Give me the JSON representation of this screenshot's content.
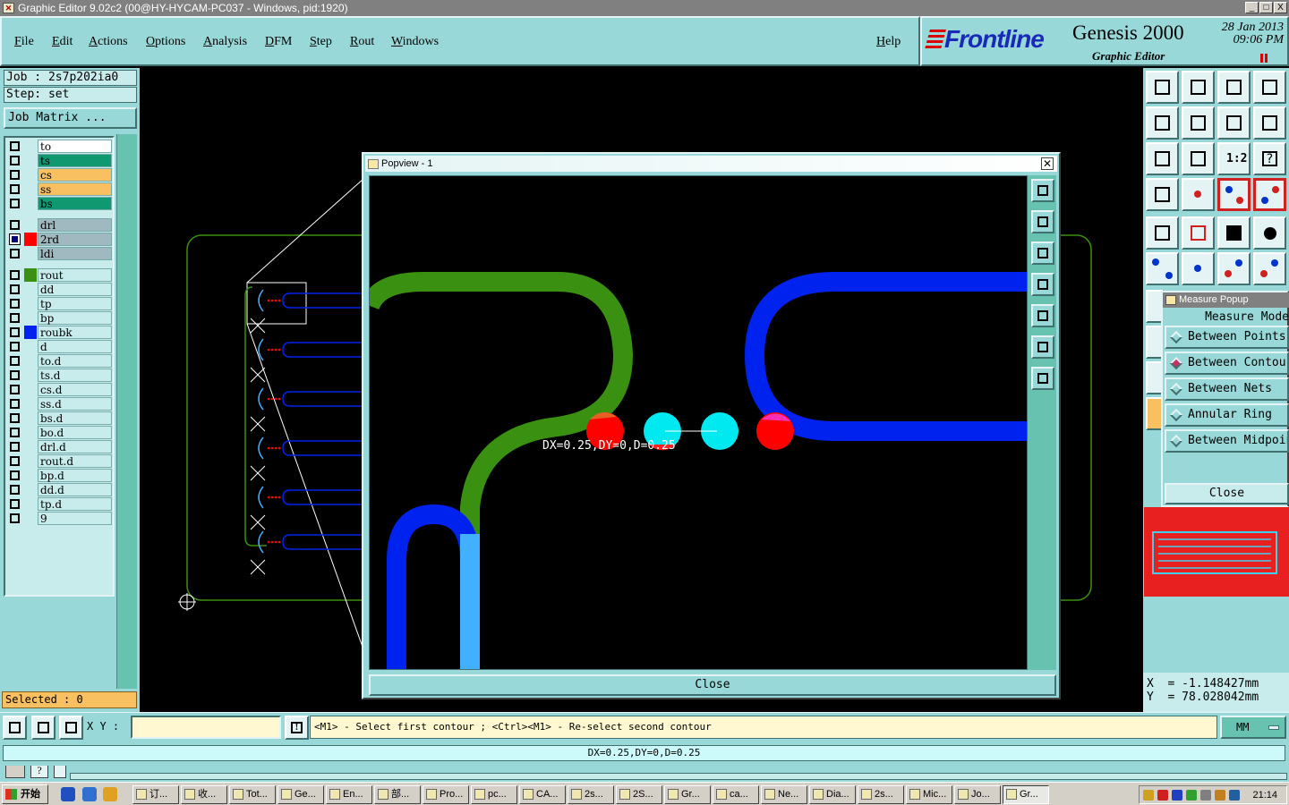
{
  "window": {
    "title": "Graphic Editor 9.02c2 (00@HY-HYCAM-PC037 - Windows, pid:1920)",
    "controls": [
      "_",
      "□",
      "X"
    ]
  },
  "menu": {
    "items": [
      "File",
      "Edit",
      "Actions",
      "Options",
      "Analysis",
      "DFM",
      "Step",
      "Rout",
      "Windows"
    ],
    "help": "Help"
  },
  "brand": {
    "logo": "Frontline",
    "product": "Genesis 2000",
    "subtitle": "Graphic Editor",
    "date": "28 Jan 2013",
    "time": "09:06 PM"
  },
  "job": {
    "job_label": "Job : 2s7p202ia0",
    "step_label": "Step: set",
    "matrix_button": "Job Matrix ..."
  },
  "layers": [
    {
      "name": "to",
      "color": "#ffffff",
      "checked": false
    },
    {
      "name": "ts",
      "color": "#109870",
      "checked": false
    },
    {
      "name": "cs",
      "color": "#f8c060",
      "checked": false
    },
    {
      "name": "ss",
      "color": "#f8c060",
      "checked": false
    },
    {
      "name": "bs",
      "color": "#109870",
      "checked": false
    },
    {
      "name": "drl",
      "color": "#a0b8c0",
      "checked": false
    },
    {
      "name": "2rd",
      "color": "#a0b8c0",
      "checked": true,
      "swatch": "#ff0000"
    },
    {
      "name": "ldi",
      "color": "#a0b8c0",
      "checked": false
    },
    {
      "name": "rout",
      "color": "#c8ecec",
      "checked": false,
      "swatch": "#3a9010"
    },
    {
      "name": "dd",
      "color": "#c8ecec",
      "checked": false
    },
    {
      "name": "tp",
      "color": "#c8ecec",
      "checked": false
    },
    {
      "name": "bp",
      "color": "#c8ecec",
      "checked": false
    },
    {
      "name": "roubk",
      "color": "#c8ecec",
      "checked": false,
      "swatch": "#0022ee"
    },
    {
      "name": "d",
      "color": "#c8ecec",
      "checked": false
    },
    {
      "name": "to.d",
      "color": "#c8ecec",
      "checked": false
    },
    {
      "name": "ts.d",
      "color": "#c8ecec",
      "checked": false
    },
    {
      "name": "cs.d",
      "color": "#c8ecec",
      "checked": false
    },
    {
      "name": "ss.d",
      "color": "#c8ecec",
      "checked": false
    },
    {
      "name": "bs.d",
      "color": "#c8ecec",
      "checked": false
    },
    {
      "name": "bo.d",
      "color": "#c8ecec",
      "checked": false
    },
    {
      "name": "drl.d",
      "color": "#c8ecec",
      "checked": false
    },
    {
      "name": "rout.d",
      "color": "#c8ecec",
      "checked": false
    },
    {
      "name": "bp.d",
      "color": "#c8ecec",
      "checked": false
    },
    {
      "name": "dd.d",
      "color": "#c8ecec",
      "checked": false
    },
    {
      "name": "tp.d",
      "color": "#c8ecec",
      "checked": false
    },
    {
      "name": "9",
      "color": "#c8ecec",
      "checked": false
    }
  ],
  "selected": "Selected : 0",
  "popview": {
    "title": "Popview - 1",
    "measure_label": "DX=0.25,DY=0,D=0.25",
    "close": "Close"
  },
  "measure_popup": {
    "title": "Measure Popup",
    "mode_heading": "Measure Mode",
    "options": [
      {
        "label": "Between Points",
        "selected": false
      },
      {
        "label": "Between Contours",
        "selected": true
      },
      {
        "label": "Between Nets",
        "selected": false
      },
      {
        "label": "Annular Ring",
        "selected": false
      },
      {
        "label": "Between Midpoints",
        "selected": false
      }
    ],
    "close": "Close"
  },
  "coords": {
    "x": "X  = -1.148427mm",
    "y": "Y  = 78.028042mm"
  },
  "command": {
    "xy_label": "X Y :",
    "xy_value": "",
    "hint": "<M1> - Select first contour ; <Ctrl><M1> - Re-select second contour",
    "units": "MM",
    "result": "DX=0.25,DY=0,D=0.25"
  },
  "taskbar": {
    "start": "开始",
    "tasks": [
      "订...",
      "收...",
      "Tot...",
      "Ge...",
      "En...",
      "部...",
      "Pro...",
      "pc...",
      "CA...",
      "2s...",
      "2S...",
      "Gr...",
      "ca...",
      "Ne...",
      "Dia...",
      "2s...",
      "Mic...",
      "Jo...",
      "Gr..."
    ],
    "active_task": 18,
    "clock": "21:14"
  },
  "colors": {
    "panel": "#99d8d8",
    "rout": "#3a9010",
    "roubk": "#0022ee",
    "pad_red": "#ff0000",
    "pad_cyan": "#00e8f0",
    "trace_light": "#40b0ff"
  }
}
